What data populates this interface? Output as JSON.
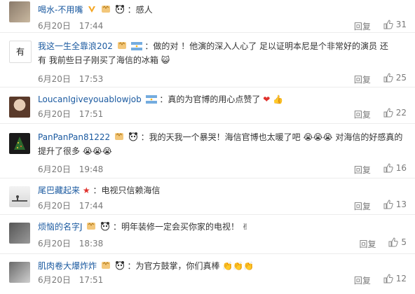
{
  "comments": [
    {
      "user": "喝水-不用嘴",
      "text": "：感人",
      "date": "6月20日",
      "time": "17:44",
      "reply": "回复",
      "likes": "31"
    },
    {
      "user": "我这一生全靠浪202",
      "text": "：做的对 ！他演的深入人心了 足以证明本尼是个非常好的演员 还",
      "text2": "有 我前些日子刚买了海信的冰箱",
      "date": "6月20日",
      "time": "17:53",
      "reply": "回复",
      "likes": "25"
    },
    {
      "user": "LoucanIgiveyouablowjob",
      "text": "：真的为官博的用心点赞了",
      "date": "6月20日",
      "time": "17:51",
      "reply": "回复",
      "likes": "22"
    },
    {
      "user": "PanPanPan81222",
      "text": "：我的天我一个暴哭！海信官博也太暖了吧",
      "text_after": "对海信的好感真的",
      "text2": "提升了很多",
      "date": "6月20日",
      "time": "19:48",
      "reply": "回复",
      "likes": "16"
    },
    {
      "user": "尾巴藏起来",
      "text": "：电视只信赖海信",
      "date": "6月20日",
      "time": "17:44",
      "reply": "回复",
      "likes": "13"
    },
    {
      "user": "烦恼的名字J",
      "text": "：明年装修一定会买你家的电视！",
      "date": "6月20日",
      "time": "18:38",
      "reply": "回复",
      "likes": "5"
    },
    {
      "user": "肌肉卷大爆炸炸",
      "text": "：为官方鼓掌，你们真棒",
      "date": "6月20日",
      "time": "17:51",
      "reply": "回复",
      "likes": "12"
    }
  ],
  "icons": {
    "like": "thumbs-up-icon",
    "badge_v": "v-badge-icon",
    "badge_flag": "argentina-flag-icon",
    "badge_cat": "cat-badge-icon",
    "badge_panda": "panda-badge-icon"
  },
  "colors": {
    "username": "#1b5aa0",
    "meta": "#7a7a7a",
    "divider": "#ececec"
  }
}
